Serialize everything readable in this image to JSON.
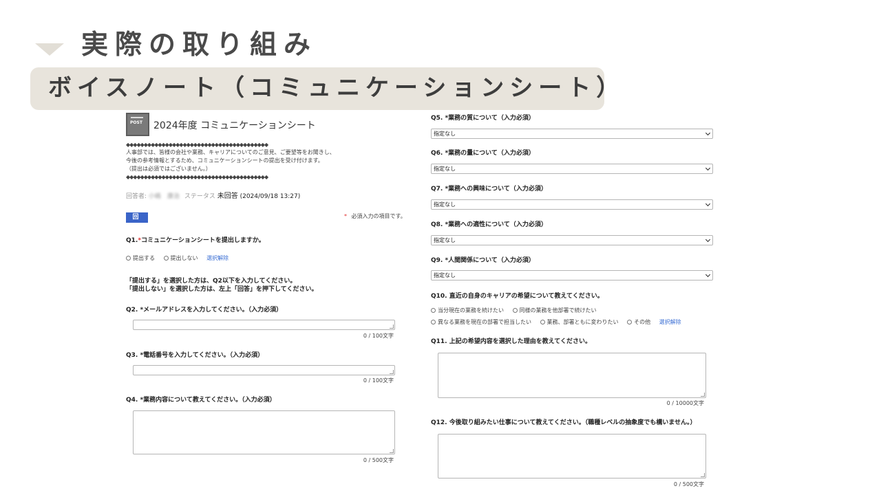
{
  "slide": {
    "title": "実際の取り組み",
    "subtitle": "ボイスノート（コミュニケーションシート）"
  },
  "form": {
    "icon_label": "POST",
    "title": "2024年度 コミュニケーションシート",
    "intro_divider": "◆◆◆◆◆◆◆◆◆◆◆◆◆◆◆◆◆◆◆◆◆◆◆◆◆◆◆◆◆◆◆◆◆◆◆◆◆◆◆◆",
    "intro_lines": [
      "人事部では、皆様の会社や業務、キャリアについてのご意見、ご要望等をお聞きし、",
      "今後の参考情報とするため、コミュニケーションシートの提出を受け付けます。",
      "（提出は必須ではございません。）"
    ],
    "respondent_label": "回答者:",
    "respondent_name": "小嶋　康治",
    "status_label": "ステータス",
    "status_value": "未回答",
    "status_date": "(2024/09/18 13:27)",
    "answer_button": "回 答",
    "required_note_mark": "*",
    "required_note": "必須入力の項目です。",
    "q1": {
      "number": "Q1.",
      "mark": "*",
      "text": "コミュニケーションシートを提出しますか。",
      "options": [
        "提出する",
        "提出しない"
      ],
      "clear": "選択解除"
    },
    "instruction_lines": [
      "「提出する」を選択した方は、Q2以下を入力してください。",
      "「提出しない」を選択した方は、左上「回答」を押下してください。"
    ],
    "q2": {
      "label": "Q2.  *メールアドレスを入力してください。（入力必須）",
      "counter": "0 / 100文字"
    },
    "q3": {
      "label": "Q3.  *電話番号を入力してください。（入力必須）",
      "counter": "0 / 100文字"
    },
    "q4": {
      "label": "Q4.  *業務内容について教えてください。（入力必須）",
      "counter": "0 / 500文字"
    },
    "q5": {
      "label": "Q5.  *業務の質について（入力必須）",
      "value": "指定なし"
    },
    "q6": {
      "label": "Q6.  *業務の量について（入力必須）",
      "value": "指定なし"
    },
    "q7": {
      "label": "Q7.  *業務への興味について（入力必須）",
      "value": "指定なし"
    },
    "q8": {
      "label": "Q8.  *業務への適性について（入力必須）",
      "value": "指定なし"
    },
    "q9": {
      "label": "Q9.  *人間関係について（入力必須）",
      "value": "指定なし"
    },
    "q10": {
      "label": "Q10.  直近の自身のキャリアの希望について教えてください。",
      "options_row1": [
        "当分現在の業務を続けたい",
        "同様の業務を他部署で続けたい"
      ],
      "options_row2": [
        "異なる業務を現在の部署で担当したい",
        "業務、部署ともに変わりたい",
        "その他"
      ],
      "clear": "選択解除"
    },
    "q11": {
      "label": "Q11.  上記の希望内容を選択した理由を教えてください。",
      "counter": "0 / 10000文字"
    },
    "q12": {
      "label": "Q12.  今後取り組みたい仕事について教えてください。（職種レベルの抽象度でも構いません。）",
      "counter": "0 / 500文字"
    }
  }
}
